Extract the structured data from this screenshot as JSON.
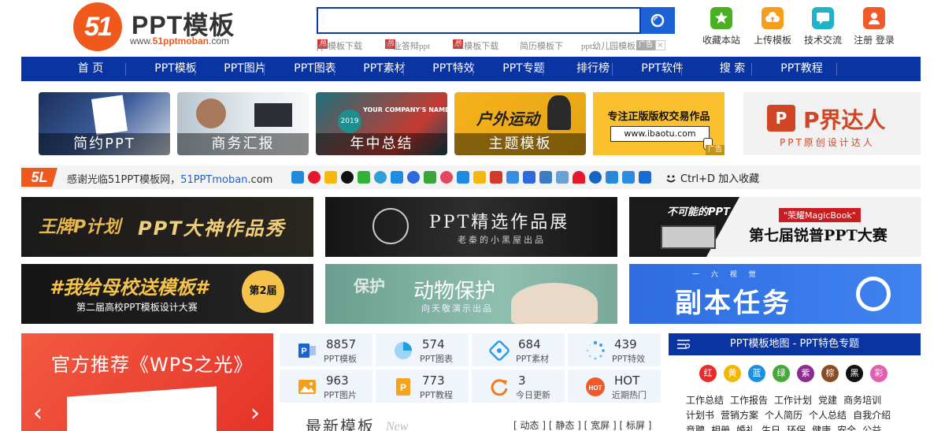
{
  "header": {
    "logo_mark": "51",
    "logo_title": "PPT模板",
    "logo_url_prefix": "www.",
    "logo_url_brand": "51pptmoban",
    "logo_url_suffix": ".com",
    "search_value": "",
    "hot_links": [
      "ppt模板下载",
      "毕业答辩ppt",
      "PPt模板下载",
      "简历模板下",
      "ppt幼儿园模板"
    ],
    "hot_badge": "热",
    "ad_label": "广告",
    "ad_close": "×",
    "top_icons": [
      {
        "label": "收藏本站",
        "icon": "star-icon",
        "color": "#49b024"
      },
      {
        "label": "上传模板",
        "icon": "upload-cloud-icon",
        "color": "#f59d1c"
      },
      {
        "label": "技术交流",
        "icon": "chat-icon",
        "color": "#20b3c8"
      },
      {
        "label": "注册 登录",
        "icon": "user-icon",
        "color": "#f05a28"
      }
    ]
  },
  "nav": [
    "首 页",
    "PPT模板",
    "PPT图片",
    "PPT图表",
    "PPT素材",
    "PPT特效",
    "PPT专题",
    "排行榜",
    "PPT软件",
    "搜 索",
    "PPT教程"
  ],
  "banners": [
    {
      "caption": "简约PPT"
    },
    {
      "caption": "商务汇报"
    },
    {
      "caption": "年中总结",
      "title": "YOUR COMPANY'S NAME",
      "year": "2019"
    },
    {
      "caption": "主题模板",
      "title": "户外运动"
    },
    {
      "line1": "专注正版版权交易作品",
      "line2": "www.ibaotu.com",
      "ad": "广告"
    },
    {
      "title": "P界达人",
      "subtitle": "PPT原创设计达人"
    }
  ],
  "sharebar": {
    "logo": "5L",
    "text_prefix": "感谢光临51PPT模板网，",
    "text_brand": "51PPTmoban",
    "text_suffix": ".com",
    "collect": "Ctrl+D 加入收藏"
  },
  "big_banners": [
    {
      "title": "王牌P计划",
      "sub": "PPT大神作品秀"
    },
    {
      "title": "PPT精选作品展",
      "sub": "老秦的小黑屋出品"
    },
    {
      "title": "不可能的PPT",
      "badge": "\"荣耀MagicBook\"",
      "sub": "第七届锐普PPT大赛"
    },
    {
      "title": "#我给母校送模板#",
      "sub": "第二届高校PPT模板设计大赛",
      "badge": "第2届"
    },
    {
      "title": "动物保护",
      "sub": "向天敬演示出品",
      "side": "保护"
    },
    {
      "title": "副本任务",
      "sub": "一 六 视 觉"
    }
  ],
  "wps": {
    "title": "官方推荐《WPS之光》",
    "prev": "‹",
    "next": "›"
  },
  "stats": [
    {
      "num": "8857",
      "label": "PPT模板",
      "icon": "ppt-icon",
      "color": "#1d62d4"
    },
    {
      "num": "574",
      "label": "PPT图表",
      "icon": "pie-chart-icon",
      "color": "#1d9ee6"
    },
    {
      "num": "684",
      "label": "PPT素材",
      "icon": "puzzle-icon",
      "color": "#2a9be6"
    },
    {
      "num": "439",
      "label": "PPT特效",
      "icon": "loading-icon",
      "color": "#3aa0e8"
    },
    {
      "num": "963",
      "label": "PPT图片",
      "icon": "image-icon",
      "color": "#f59d1c"
    },
    {
      "num": "773",
      "label": "PPT教程",
      "icon": "tutorial-icon",
      "color": "#f5a21c"
    },
    {
      "num": "3",
      "label": "今日更新",
      "icon": "refresh-icon",
      "color": "#f07a1c"
    },
    {
      "num": "HOT",
      "label": "近期热门",
      "icon": "hot-icon",
      "color": "#f05a28"
    }
  ],
  "newest": {
    "title": "最新模板",
    "en": "New"
  },
  "filters": [
    "[ 动态 ]",
    "[ 静态 ]",
    "[ 宽屏 ]",
    "[ 标屏 ]"
  ],
  "map": {
    "title": "PPT模板地图 - PPT特色专题",
    "colors": [
      {
        "label": "红",
        "color": "#e62c2c"
      },
      {
        "label": "黄",
        "color": "#f2b705"
      },
      {
        "label": "蓝",
        "color": "#1f8de0"
      },
      {
        "label": "绿",
        "color": "#46a73a"
      },
      {
        "label": "紫",
        "color": "#8b2d8f"
      },
      {
        "label": "棕",
        "color": "#8a4b2b"
      },
      {
        "label": "黑",
        "color": "#111111"
      },
      {
        "label": "彩",
        "color": "#e05fb0"
      }
    ],
    "tags": [
      "工作总结",
      "工作报告",
      "工作计划",
      "党建",
      "商务培训",
      "计划书",
      "营销方案",
      "个人简历",
      "个人总结",
      "自我介绍",
      "竞聘",
      "相册",
      "婚礼",
      "生日",
      "环保",
      "健康",
      "安全",
      "公益"
    ]
  }
}
